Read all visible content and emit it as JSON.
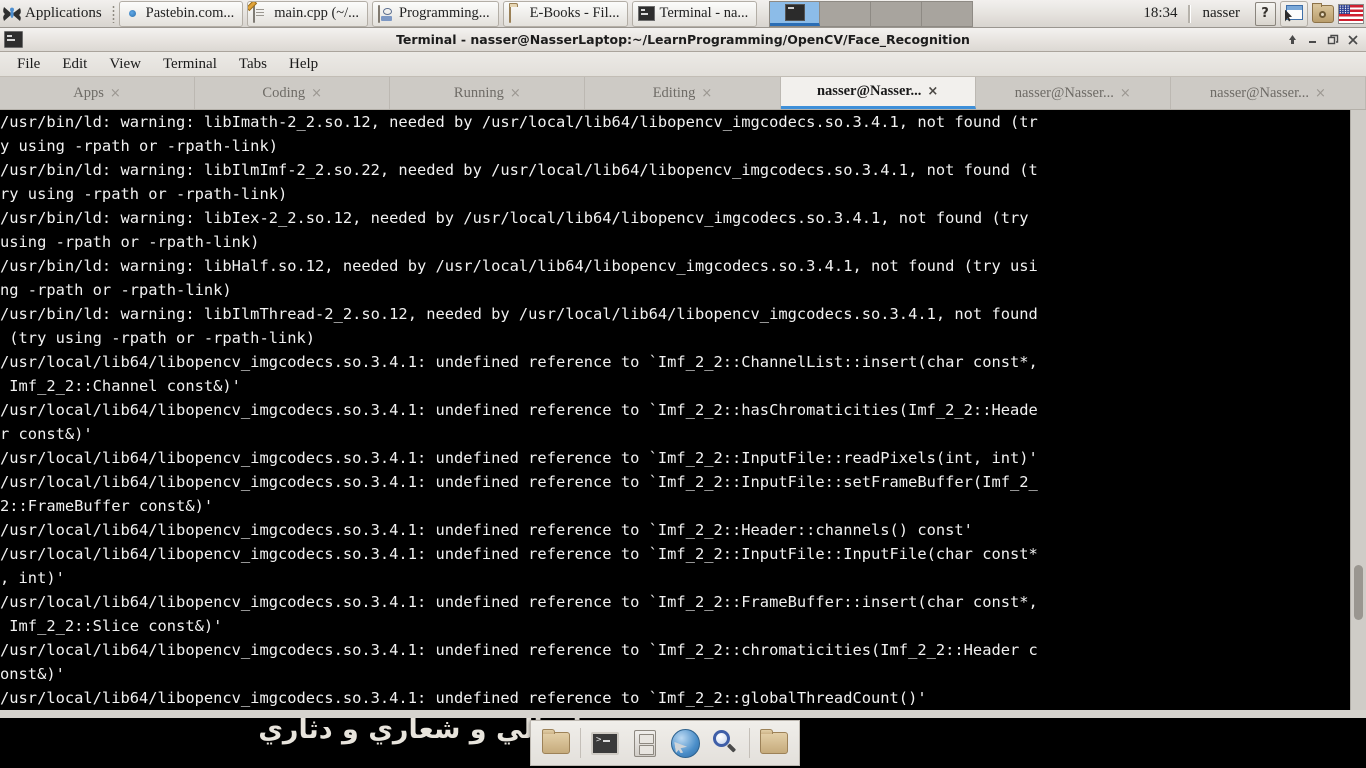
{
  "top_panel": {
    "applications_label": "Applications",
    "applications_icon": "butterfly-icon",
    "tasks": [
      {
        "label": "Pastebin.com...",
        "icon": "firefox-icon"
      },
      {
        "label": "main.cpp (~/...",
        "icon": "text-editor-icon"
      },
      {
        "label": "Programming...",
        "icon": "program-window-icon"
      },
      {
        "label": "E-Books - Fil...",
        "icon": "folder-icon"
      },
      {
        "label": "Terminal - na...",
        "icon": "terminal-icon"
      }
    ],
    "workspaces": [
      {
        "name": "workspace-1",
        "active": true
      },
      {
        "name": "workspace-2",
        "active": false
      },
      {
        "name": "workspace-3",
        "active": false
      },
      {
        "name": "workspace-4",
        "active": false
      }
    ],
    "clock": "18:34",
    "username": "nasser",
    "tray": [
      {
        "name": "help-icon",
        "glyph": "?"
      },
      {
        "name": "screenshot-window-icon"
      },
      {
        "name": "screenshot-folder-icon"
      },
      {
        "name": "keyboard-layout-us-flag-icon"
      }
    ]
  },
  "window": {
    "title": "Terminal - nasser@NasserLaptop:~/LearnProgramming/OpenCV/Face_Recognition",
    "icon": "terminal-icon",
    "controls": {
      "shade": "⬆",
      "minimize": "–",
      "maximize": "❐",
      "close": "✕"
    },
    "menu": [
      "File",
      "Edit",
      "View",
      "Terminal",
      "Tabs",
      "Help"
    ],
    "tabs": [
      {
        "label": "Apps",
        "active": false,
        "close": "×"
      },
      {
        "label": "Coding",
        "active": false,
        "close": "×"
      },
      {
        "label": "Running",
        "active": false,
        "close": "×"
      },
      {
        "label": "Editing",
        "active": false,
        "close": "×"
      },
      {
        "label": "nasser@Nasser...",
        "active": true,
        "close": "×"
      },
      {
        "label": "nasser@Nasser...",
        "active": false,
        "close": "×"
      },
      {
        "label": "nasser@Nasser...",
        "active": false,
        "close": "×"
      }
    ]
  },
  "terminal": {
    "lines": [
      "/usr/bin/ld: warning: libImath-2_2.so.12, needed by /usr/local/lib64/libopencv_imgcodecs.so.3.4.1, not found (tr",
      "y using -rpath or -rpath-link)",
      "/usr/bin/ld: warning: libIlmImf-2_2.so.22, needed by /usr/local/lib64/libopencv_imgcodecs.so.3.4.1, not found (t",
      "ry using -rpath or -rpath-link)",
      "/usr/bin/ld: warning: libIex-2_2.so.12, needed by /usr/local/lib64/libopencv_imgcodecs.so.3.4.1, not found (try",
      "using -rpath or -rpath-link)",
      "/usr/bin/ld: warning: libHalf.so.12, needed by /usr/local/lib64/libopencv_imgcodecs.so.3.4.1, not found (try usi",
      "ng -rpath or -rpath-link)",
      "/usr/bin/ld: warning: libIlmThread-2_2.so.12, needed by /usr/local/lib64/libopencv_imgcodecs.so.3.4.1, not found",
      " (try using -rpath or -rpath-link)",
      "/usr/local/lib64/libopencv_imgcodecs.so.3.4.1: undefined reference to `Imf_2_2::ChannelList::insert(char const*,",
      " Imf_2_2::Channel const&)'",
      "/usr/local/lib64/libopencv_imgcodecs.so.3.4.1: undefined reference to `Imf_2_2::hasChromaticities(Imf_2_2::Heade",
      "r const&)'",
      "/usr/local/lib64/libopencv_imgcodecs.so.3.4.1: undefined reference to `Imf_2_2::InputFile::readPixels(int, int)'",
      "/usr/local/lib64/libopencv_imgcodecs.so.3.4.1: undefined reference to `Imf_2_2::InputFile::setFrameBuffer(Imf_2_",
      "2::FrameBuffer const&)'",
      "/usr/local/lib64/libopencv_imgcodecs.so.3.4.1: undefined reference to `Imf_2_2::Header::channels() const'",
      "/usr/local/lib64/libopencv_imgcodecs.so.3.4.1: undefined reference to `Imf_2_2::InputFile::InputFile(char const*",
      ", int)'",
      "/usr/local/lib64/libopencv_imgcodecs.so.3.4.1: undefined reference to `Imf_2_2::FrameBuffer::insert(char const*,",
      " Imf_2_2::Slice const&)'",
      "/usr/local/lib64/libopencv_imgcodecs.so.3.4.1: undefined reference to `Imf_2_2::chromaticities(Imf_2_2::Header c",
      "onst&)'",
      "/usr/local/lib64/libopencv_imgcodecs.so.3.4.1: undefined reference to `Imf_2_2::globalThreadCount()'"
    ]
  },
  "desktop": {
    "wallpaper_text": "ـا حالي و شعاري و دثاري",
    "dock_items": [
      {
        "name": "home-folder-icon"
      },
      {
        "name": "terminal-icon"
      },
      {
        "name": "file-manager-icon"
      },
      {
        "name": "web-browser-icon"
      },
      {
        "name": "search-icon"
      },
      {
        "name": "folder-icon"
      }
    ]
  },
  "colors": {
    "accent": "#3e8fd8",
    "workspace_active": "#8cbce8",
    "panel": "#e6e3df",
    "terminal_bg": "#000000",
    "terminal_fg": "#f2f2f2"
  }
}
